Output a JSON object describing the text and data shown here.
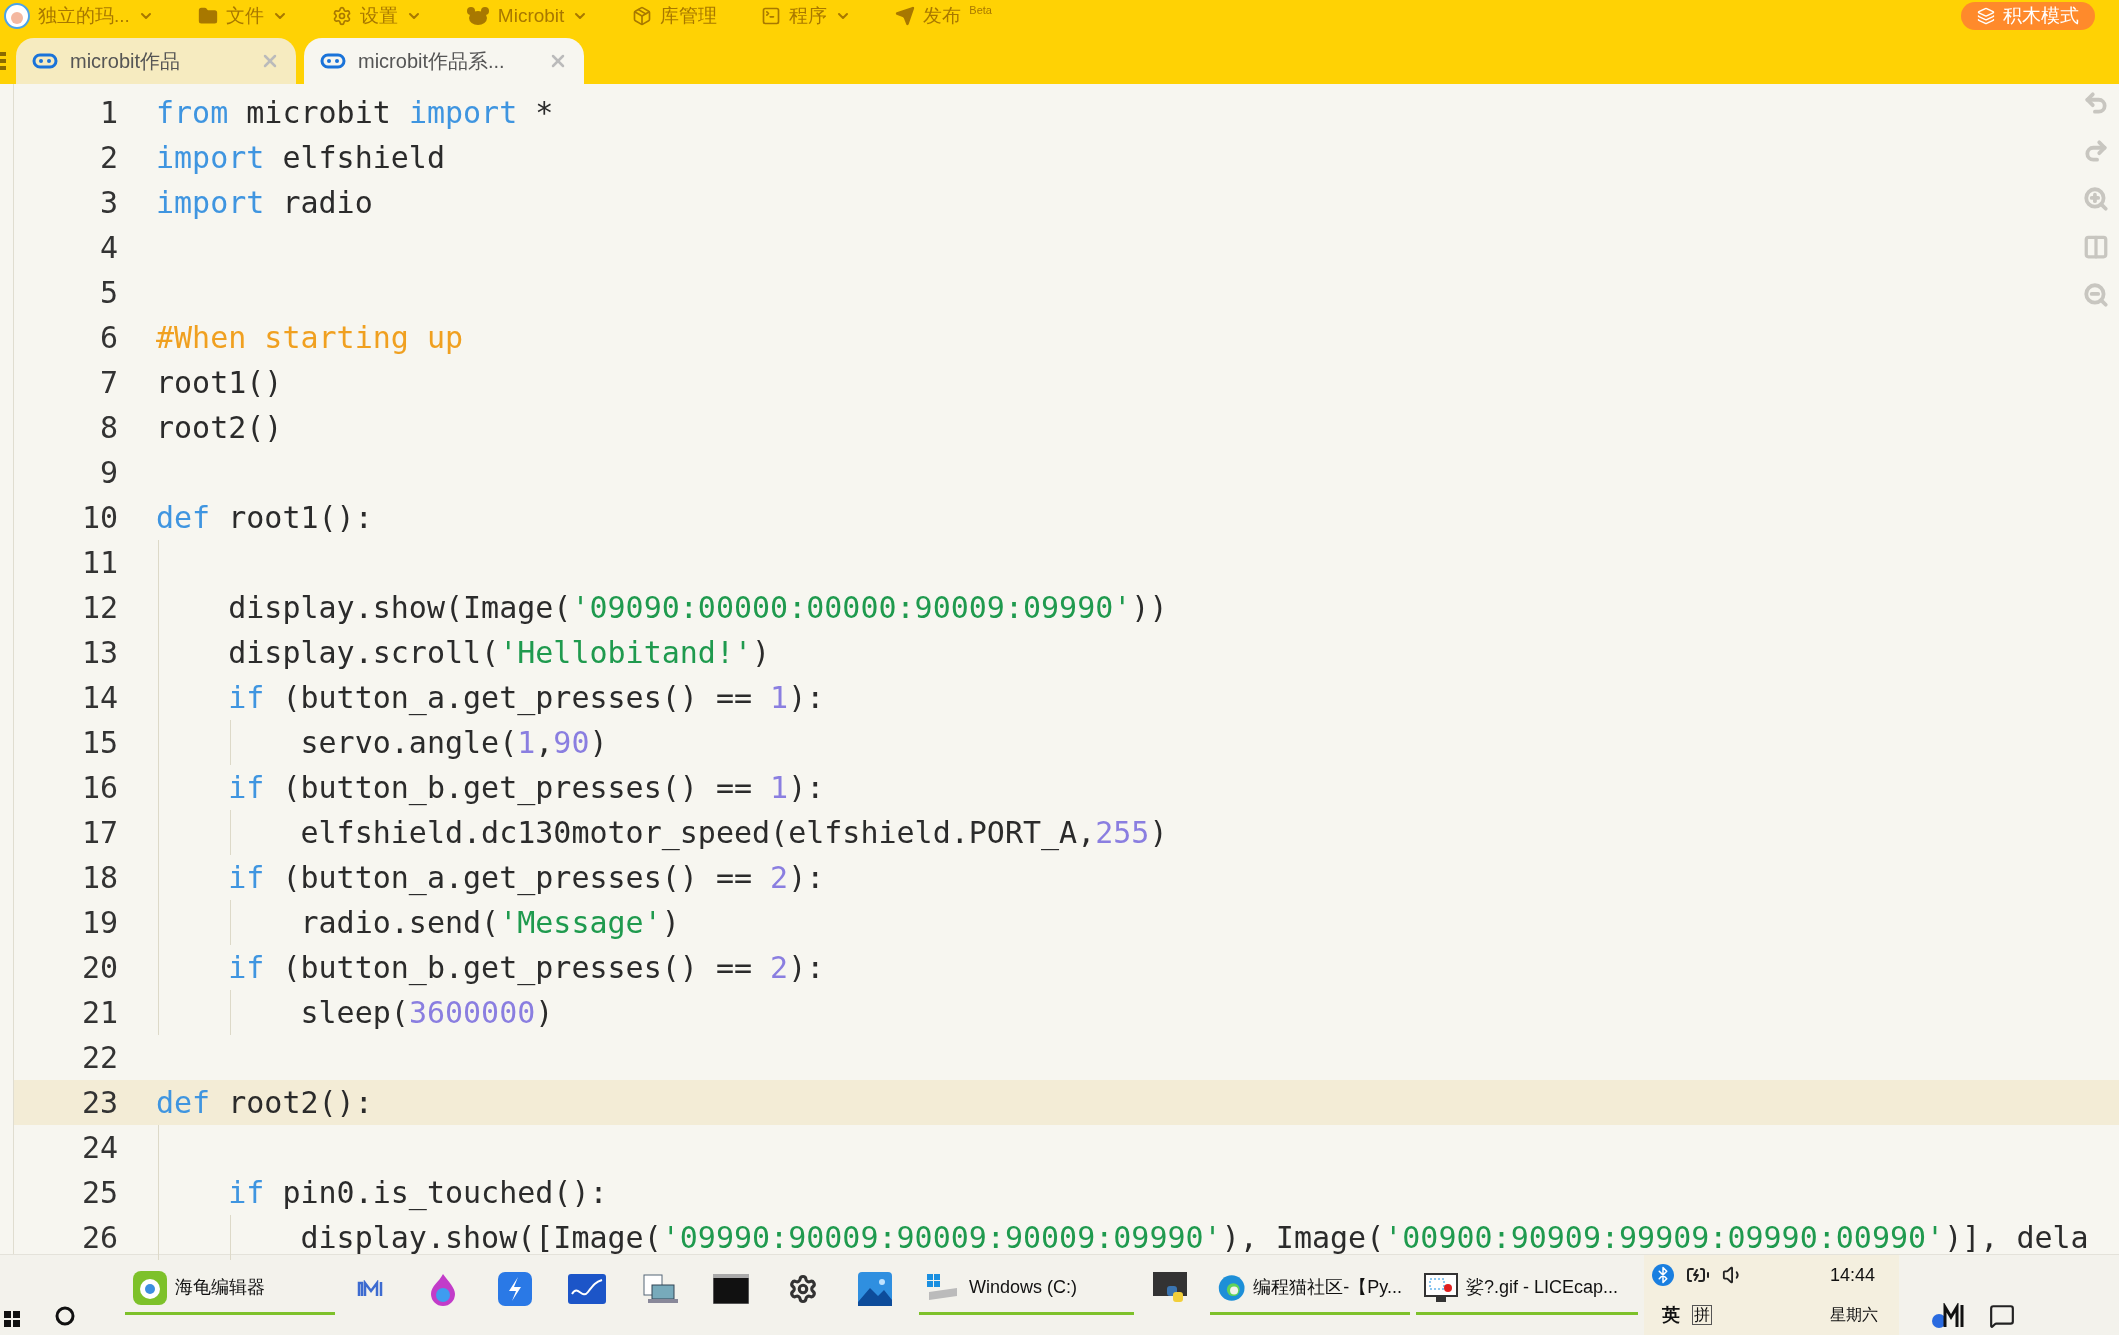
{
  "menu_bar": {
    "user": "独立的玛...",
    "items": [
      {
        "label": "文件",
        "has_caret": true
      },
      {
        "label": "设置",
        "has_caret": true
      },
      {
        "label": "Microbit",
        "has_caret": true
      },
      {
        "label": "库管理",
        "has_caret": false
      },
      {
        "label": "程序",
        "has_caret": true
      }
    ],
    "publish": {
      "label": "发布",
      "badge": "Beta"
    },
    "mode_button": "积木模式"
  },
  "tabs": [
    {
      "label": "microbit作品",
      "selected": false
    },
    {
      "label": "microbit作品系...",
      "selected": true
    }
  ],
  "code_lines": [
    {
      "number": "1",
      "highlighted": false,
      "tokens": [
        {
          "kind": "keyword",
          "text": "from"
        },
        {
          "kind": "plain",
          "text": " microbit "
        },
        {
          "kind": "keyword",
          "text": "import"
        },
        {
          "kind": "plain",
          "text": " *"
        }
      ]
    },
    {
      "number": "2",
      "highlighted": false,
      "tokens": [
        {
          "kind": "keyword",
          "text": "import"
        },
        {
          "kind": "plain",
          "text": " elfshield"
        }
      ]
    },
    {
      "number": "3",
      "highlighted": false,
      "tokens": [
        {
          "kind": "keyword",
          "text": "import"
        },
        {
          "kind": "plain",
          "text": " radio"
        }
      ]
    },
    {
      "number": "4",
      "highlighted": false
    },
    {
      "number": "5",
      "highlighted": false
    },
    {
      "number": "6",
      "highlighted": false,
      "tokens": [
        {
          "kind": "comment",
          "text": "#When starting up"
        }
      ]
    },
    {
      "number": "7",
      "highlighted": false,
      "tokens": [
        {
          "kind": "plain",
          "text": "root1()"
        }
      ]
    },
    {
      "number": "8",
      "highlighted": false,
      "tokens": [
        {
          "kind": "plain",
          "text": "root2()"
        }
      ]
    },
    {
      "number": "9",
      "highlighted": false
    },
    {
      "number": "10",
      "highlighted": false,
      "tokens": [
        {
          "kind": "keyword",
          "text": "def"
        },
        {
          "kind": "plain",
          "text": " root1():"
        }
      ]
    },
    {
      "number": "11",
      "highlighted": false
    },
    {
      "number": "12",
      "highlighted": false,
      "tokens": [
        {
          "kind": "plain",
          "text": "    display.show(Image("
        },
        {
          "kind": "string",
          "text": "'09090:00000:00000:90009:09990'"
        },
        {
          "kind": "plain",
          "text": "))"
        }
      ]
    },
    {
      "number": "13",
      "highlighted": false,
      "tokens": [
        {
          "kind": "plain",
          "text": "    display.scroll("
        },
        {
          "kind": "string",
          "text": "'Hellobitand!'"
        },
        {
          "kind": "plain",
          "text": ")"
        }
      ]
    },
    {
      "number": "14",
      "highlighted": false,
      "tokens": [
        {
          "kind": "keyword",
          "text": "    if"
        },
        {
          "kind": "plain",
          "text": " (button_a.get_presses() == "
        },
        {
          "kind": "number",
          "text": "1"
        },
        {
          "kind": "plain",
          "text": "):"
        }
      ]
    },
    {
      "number": "15",
      "highlighted": false,
      "tokens": [
        {
          "kind": "plain",
          "text": "        servo.angle("
        },
        {
          "kind": "number",
          "text": "1"
        },
        {
          "kind": "plain",
          "text": ","
        },
        {
          "kind": "number",
          "text": "90"
        },
        {
          "kind": "plain",
          "text": ")"
        }
      ]
    },
    {
      "number": "16",
      "highlighted": false,
      "tokens": [
        {
          "kind": "keyword",
          "text": "    if"
        },
        {
          "kind": "plain",
          "text": " (button_b.get_presses() == "
        },
        {
          "kind": "number",
          "text": "1"
        },
        {
          "kind": "plain",
          "text": "):"
        }
      ]
    },
    {
      "number": "17",
      "highlighted": false,
      "tokens": [
        {
          "kind": "plain",
          "text": "        elfshield.dc130motor_speed(elfshield.PORT_A,"
        },
        {
          "kind": "number",
          "text": "255"
        },
        {
          "kind": "plain",
          "text": ")"
        }
      ]
    },
    {
      "number": "18",
      "highlighted": false,
      "tokens": [
        {
          "kind": "keyword",
          "text": "    if"
        },
        {
          "kind": "plain",
          "text": " (button_a.get_presses() == "
        },
        {
          "kind": "number",
          "text": "2"
        },
        {
          "kind": "plain",
          "text": "):"
        }
      ]
    },
    {
      "number": "19",
      "highlighted": false,
      "tokens": [
        {
          "kind": "plain",
          "text": "        radio.send("
        },
        {
          "kind": "string",
          "text": "'Message'"
        },
        {
          "kind": "plain",
          "text": ")"
        }
      ]
    },
    {
      "number": "20",
      "highlighted": false,
      "tokens": [
        {
          "kind": "keyword",
          "text": "    if"
        },
        {
          "kind": "plain",
          "text": " (button_b.get_presses() == "
        },
        {
          "kind": "number",
          "text": "2"
        },
        {
          "kind": "plain",
          "text": "):"
        }
      ]
    },
    {
      "number": "21",
      "highlighted": false,
      "tokens": [
        {
          "kind": "plain",
          "text": "        sleep("
        },
        {
          "kind": "number",
          "text": "3600000"
        },
        {
          "kind": "plain",
          "text": ")"
        }
      ]
    },
    {
      "number": "22",
      "highlighted": false
    },
    {
      "number": "23",
      "highlighted": true,
      "tokens": [
        {
          "kind": "keyword",
          "text": "def"
        },
        {
          "kind": "plain",
          "text": " root2():"
        }
      ]
    },
    {
      "number": "24",
      "highlighted": false
    },
    {
      "number": "25",
      "highlighted": false,
      "tokens": [
        {
          "kind": "keyword",
          "text": "    if"
        },
        {
          "kind": "plain",
          "text": " pin0.is_touched():"
        }
      ]
    },
    {
      "number": "26",
      "highlighted": false,
      "tokens": [
        {
          "kind": "plain",
          "text": "        display.show([Image("
        },
        {
          "kind": "string",
          "text": "'09990:90009:90009:90009:09990'"
        },
        {
          "kind": "plain",
          "text": "), Image("
        },
        {
          "kind": "string",
          "text": "'00900:90909:99909:09990:00990'"
        },
        {
          "kind": "plain",
          "text": ")], dela"
        }
      ]
    }
  ],
  "taskbar": {
    "windows": [
      {
        "label": "海龟编辑器",
        "running": true
      },
      {
        "label": "Windows (C:)",
        "running": true
      },
      {
        "label": "编程猫社区-【Py...",
        "running": true
      },
      {
        "label": "娑?.gif - LICEcap...",
        "running": true
      }
    ],
    "tray": {
      "time": "14:44",
      "day": "星期六",
      "ime_language": "英",
      "ime_mode": "拼"
    }
  }
}
